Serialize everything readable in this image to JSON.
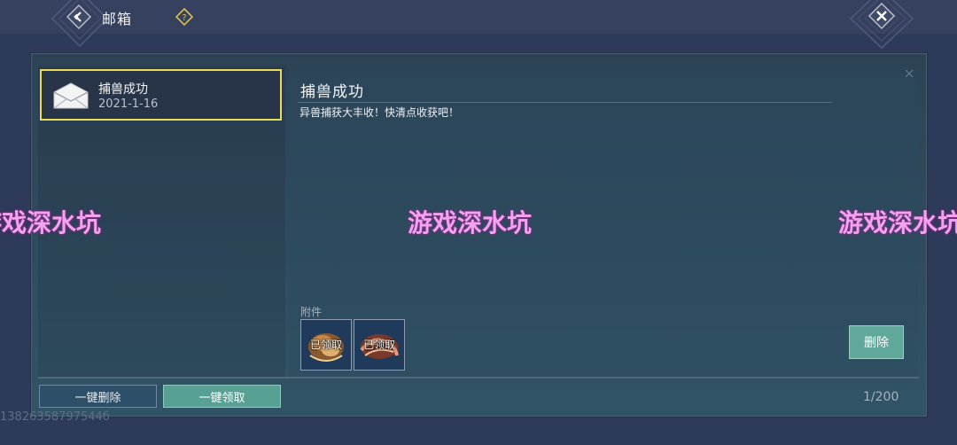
{
  "header": {
    "title": "邮箱",
    "back_icon": "back-arrow-icon",
    "help_icon": "question-icon",
    "close_icon": "close-icon"
  },
  "mail_list": [
    {
      "subject": "捕兽成功",
      "date": "2021-1-16",
      "icon": "envelope-icon",
      "selected": true
    }
  ],
  "detail": {
    "title": "捕兽成功",
    "body": "异兽捕获大丰收！快清点收获吧！",
    "attachments_label": "附件",
    "attachments": [
      {
        "status": "已领取",
        "icon": "beast-reward-icon"
      },
      {
        "status": "已领取",
        "icon": "beast-reward-icon-2"
      }
    ],
    "delete_label": "删除"
  },
  "footer": {
    "delete_all_label": "一键删除",
    "claim_all_label": "一键领取",
    "counter": "1/200"
  },
  "uid": "13826358797544б",
  "watermark": "游戏深水坑",
  "colors": {
    "selected_border": "#e8dc5a",
    "accent_teal": "#5fa89a",
    "watermark": "#f2a2ee"
  }
}
